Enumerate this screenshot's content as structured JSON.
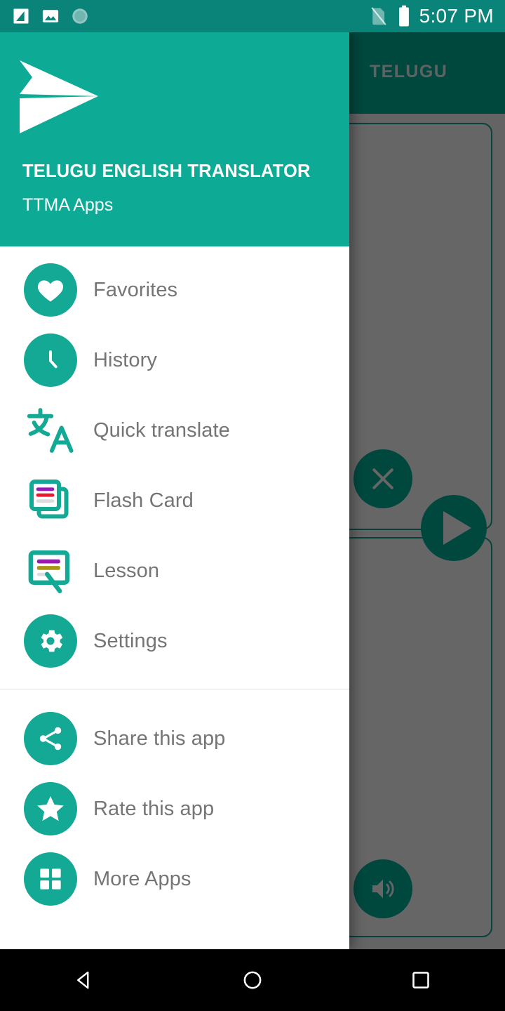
{
  "status_bar": {
    "time": "5:07 PM",
    "icons": [
      "screenshot-icon",
      "image-icon",
      "sync-icon"
    ],
    "right_icons": [
      "no-sim-icon",
      "battery-full-icon"
    ],
    "background_color": "#0a8379"
  },
  "drawer": {
    "header": {
      "logo": "paper-plane-logo",
      "title": "TELUGU ENGLISH TRANSLATOR",
      "subtitle": "TTMA Apps",
      "background_color": "#0dab96"
    },
    "primary_items": [
      {
        "label": "Favorites",
        "icon": "heart-icon"
      },
      {
        "label": "History",
        "icon": "clock-icon"
      },
      {
        "label": "Quick translate",
        "icon": "translate-icon"
      },
      {
        "label": "Flash Card",
        "icon": "flash-card-icon"
      },
      {
        "label": "Lesson",
        "icon": "lesson-icon"
      },
      {
        "label": "Settings",
        "icon": "gear-icon"
      }
    ],
    "secondary_items": [
      {
        "label": "Share this app",
        "icon": "share-icon"
      },
      {
        "label": "Rate this app",
        "icon": "star-icon"
      },
      {
        "label": "More Apps",
        "icon": "grid-icon"
      }
    ],
    "accent_color": "#13a995",
    "label_color": "#757575"
  },
  "background_app": {
    "tab_label": "TELUGU",
    "toolbar_color": "#00b39c",
    "card_border_color": "#12a594",
    "buttons": [
      {
        "name": "clear-button",
        "icon": "close-icon"
      },
      {
        "name": "send-button",
        "icon": "send-icon"
      },
      {
        "name": "speak-button",
        "icon": "volume-icon"
      }
    ],
    "scrim_opacity": "0.60"
  },
  "nav_bar": {
    "buttons": [
      {
        "label": "Back",
        "icon": "back-triangle-icon"
      },
      {
        "label": "Home",
        "icon": "home-circle-icon"
      },
      {
        "label": "Recents",
        "icon": "recents-square-icon"
      }
    ],
    "background_color": "#000000"
  }
}
